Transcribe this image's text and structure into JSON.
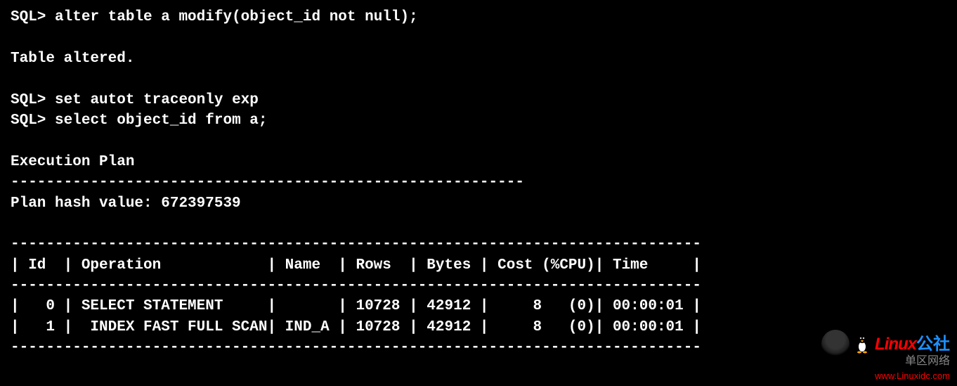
{
  "prompt": "SQL>",
  "commands": {
    "alter": "alter table a modify(object_id not null);",
    "autot": "set autot traceonly exp",
    "select": "select object_id from a;"
  },
  "responses": {
    "altered": "Table altered.",
    "exec_plan_header": "Execution Plan",
    "dash58": "----------------------------------------------------------",
    "plan_hash": "Plan hash value: 672397539"
  },
  "plan_table": {
    "border": "------------------------------------------------------------------------------",
    "header_row": "| Id  | Operation            | Name  | Rows  | Bytes | Cost (%CPU)| Time     |",
    "row0": "|   0 | SELECT STATEMENT     |       | 10728 | 42912 |     8   (0)| 00:00:01 |",
    "row1": "|   1 |  INDEX FAST FULL SCAN| IND_A | 10728 | 42912 |     8   (0)| 00:00:01 |"
  },
  "chart_data": {
    "type": "table",
    "title": "Execution Plan",
    "plan_hash_value": 672397539,
    "columns": [
      "Id",
      "Operation",
      "Name",
      "Rows",
      "Bytes",
      "Cost (%CPU)",
      "Time"
    ],
    "rows": [
      {
        "Id": 0,
        "Operation": "SELECT STATEMENT",
        "Name": "",
        "Rows": 10728,
        "Bytes": 42912,
        "Cost": 8,
        "CPU_pct": 0,
        "Time": "00:00:01"
      },
      {
        "Id": 1,
        "Operation": "INDEX FAST FULL SCAN",
        "Name": "IND_A",
        "Rows": 10728,
        "Bytes": 42912,
        "Cost": 8,
        "CPU_pct": 0,
        "Time": "00:00:01"
      }
    ]
  },
  "watermark": {
    "brand_main": "Linux",
    "brand_suffix": "公社",
    "brand_cn": "单区网络",
    "url": "www.Linuxidc.com"
  }
}
